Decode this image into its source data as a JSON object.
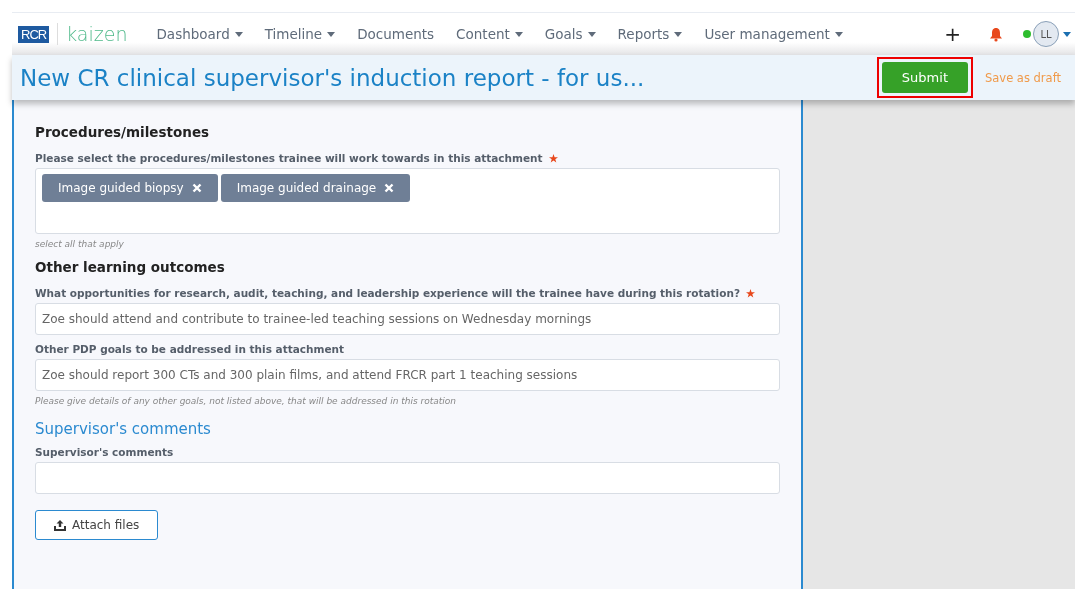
{
  "nav": {
    "logo": "RCR",
    "brand": "kaizen",
    "items": [
      {
        "label": "Dashboard",
        "dropdown": true
      },
      {
        "label": "Timeline",
        "dropdown": true
      },
      {
        "label": "Documents",
        "dropdown": false
      },
      {
        "label": "Content",
        "dropdown": true
      },
      {
        "label": "Goals",
        "dropdown": true
      },
      {
        "label": "Reports",
        "dropdown": true
      },
      {
        "label": "User management",
        "dropdown": true
      }
    ],
    "plus": "+",
    "avatar": "LL",
    "online": true
  },
  "header": {
    "title": "New CR clinical supervisor's induction report - for us...",
    "buttons": [
      {
        "label": "Submit",
        "kind": "primary",
        "highlighted": true
      },
      {
        "label": "Save as draft",
        "kind": "link",
        "highlighted": false
      }
    ]
  },
  "sections": [
    {
      "heading": "Procedures/milestones",
      "kind": "main",
      "fields": [
        {
          "kind": "tags",
          "label": "Please select the procedures/milestones trainee will work towards in this attachment",
          "required": true,
          "tags": [
            "Image guided biopsy",
            "Image guided drainage"
          ],
          "hint": "select all that apply"
        }
      ]
    },
    {
      "heading": "Other learning outcomes",
      "kind": "main",
      "fields": [
        {
          "kind": "text",
          "label": "What opportunities for research, audit, teaching, and leadership experience will the trainee have during this rotation?",
          "required": true,
          "value": "Zoe should attend and contribute to trainee-led teaching sessions on Wednesday mornings"
        },
        {
          "kind": "text",
          "label": "Other PDP goals to be addressed in this attachment",
          "required": false,
          "value": "Zoe should report 300 CTs and 300 plain films, and attend FRCR part 1 teaching sessions",
          "hint": "Please give details of any other goals, not listed above, that will be addressed in this rotation"
        }
      ]
    },
    {
      "heading": "Supervisor's comments",
      "kind": "comments",
      "fields": [
        {
          "kind": "text",
          "label": "Supervisor's comments",
          "required": false
        }
      ]
    }
  ],
  "attach": {
    "label": "Attach files"
  }
}
